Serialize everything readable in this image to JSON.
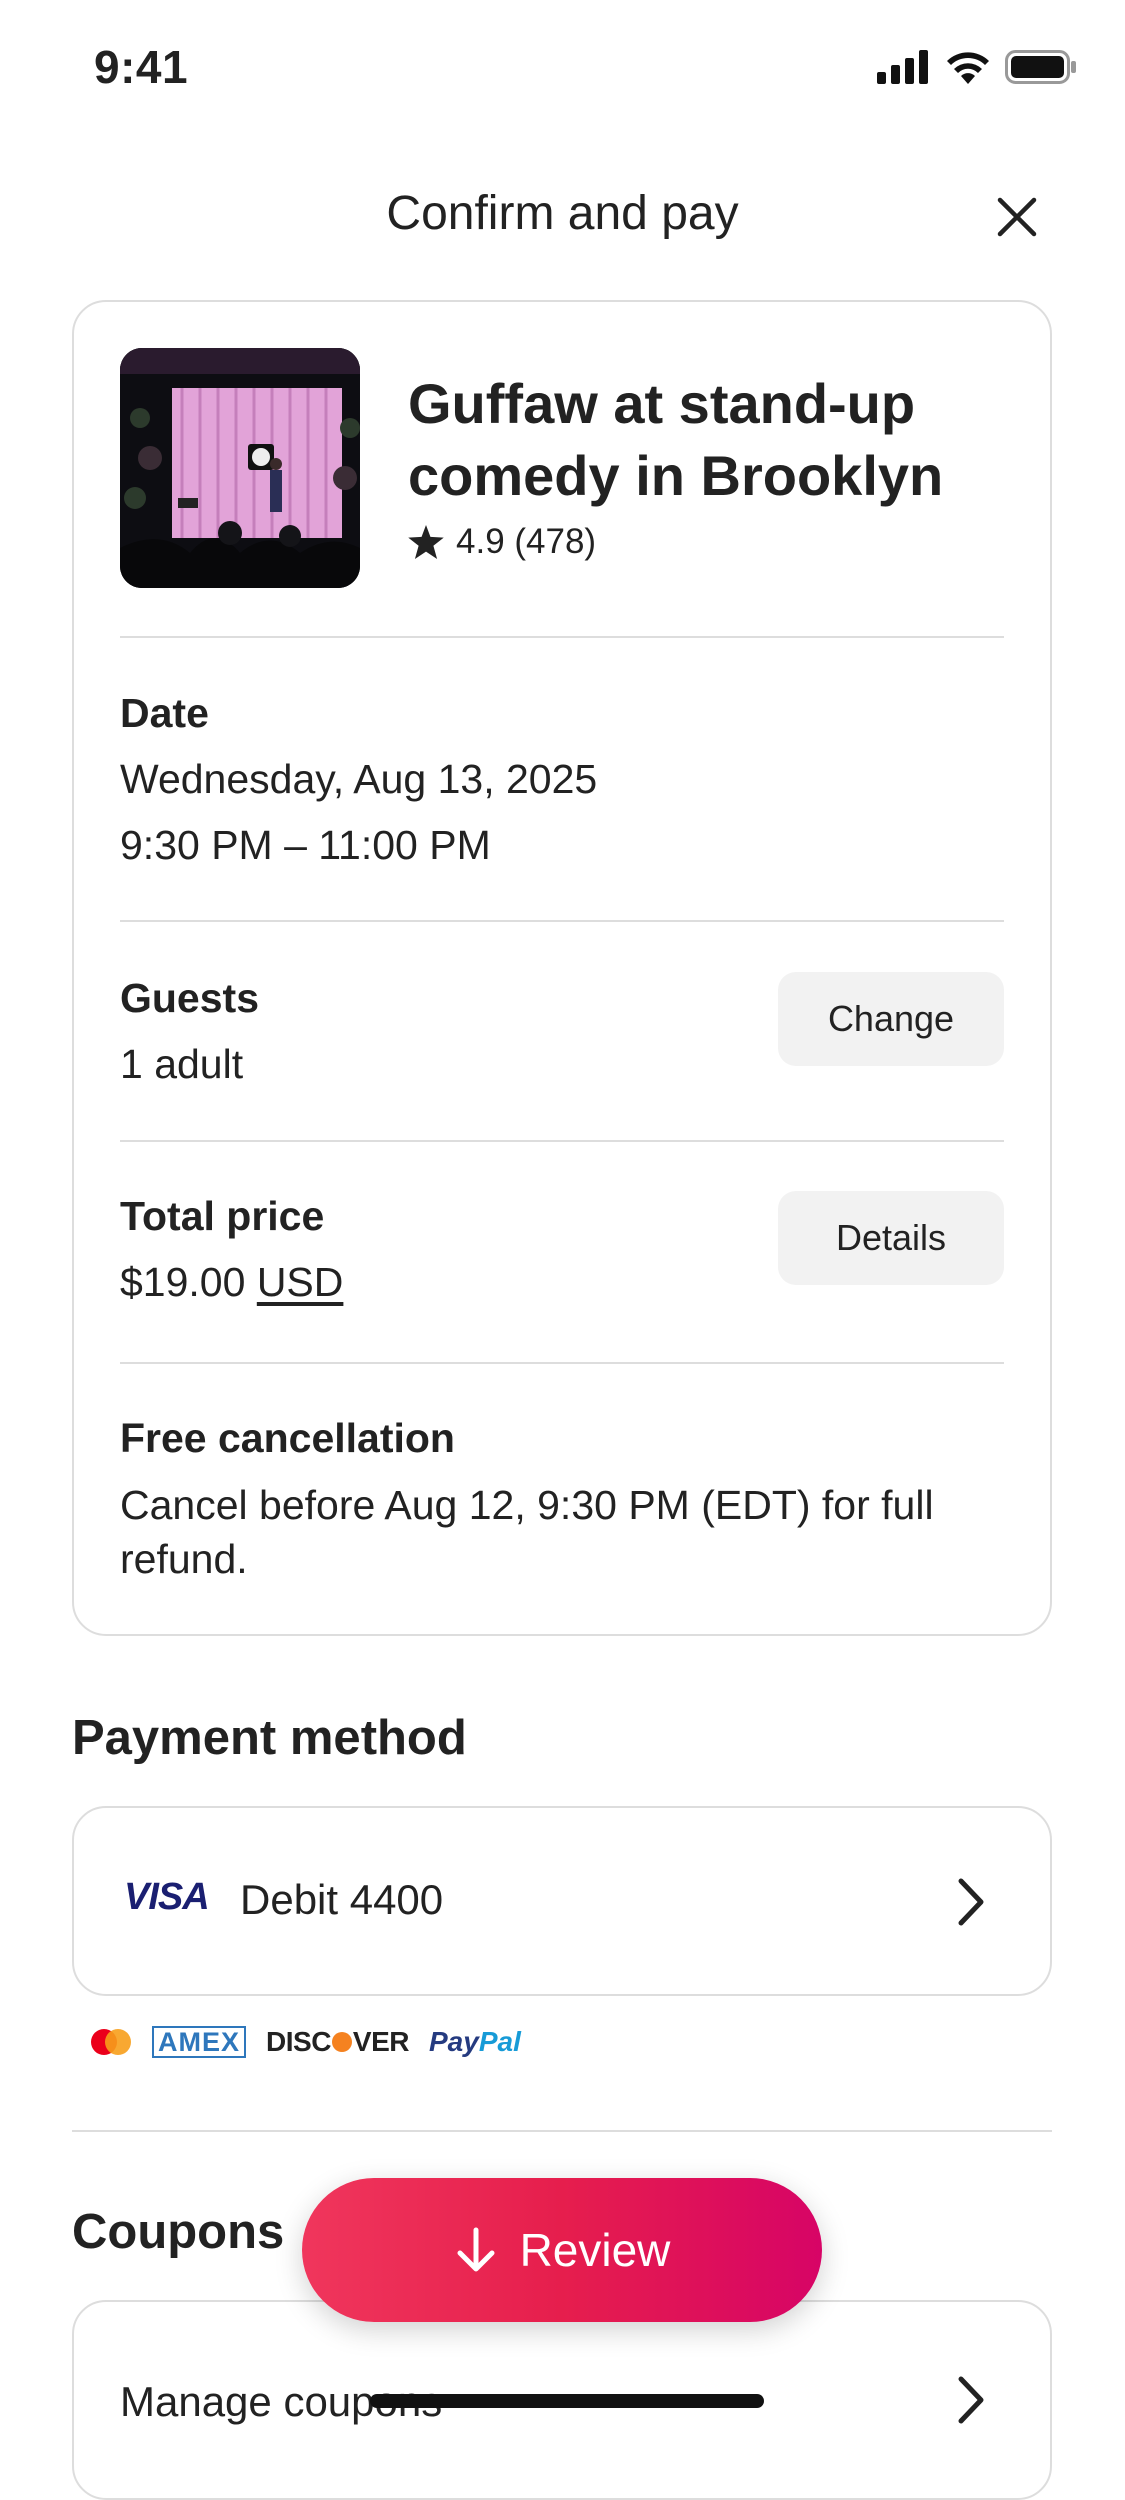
{
  "status_bar": {
    "time": "9:41"
  },
  "header": {
    "title": "Confirm and pay"
  },
  "listing": {
    "title": "Guffaw at stand-up comedy in Brooklyn",
    "rating": "4.9 (478)"
  },
  "date": {
    "label": "Date",
    "day": "Wednesday, Aug 13, 2025",
    "time": "9:30 PM – 11:00 PM"
  },
  "guests": {
    "label": "Guests",
    "value": "1 adult",
    "button": "Change"
  },
  "price": {
    "label": "Total price",
    "amount": "$19.00",
    "currency": "USD",
    "button": "Details"
  },
  "cancellation": {
    "label": "Free cancellation",
    "text": "Cancel before Aug 12, 9:30 PM (EDT) for full refund."
  },
  "payment": {
    "heading": "Payment method",
    "card_brand": "VISA",
    "card_label": "Debit 4400",
    "brands": {
      "amex": "AMEX",
      "discover_a": "DISC",
      "discover_b": "VER",
      "paypal_a": "Pay",
      "paypal_b": "Pal"
    }
  },
  "coupons": {
    "heading": "Coupons",
    "manage": "Manage coupons"
  },
  "review_button": {
    "label": "Review"
  },
  "colors": {
    "accent": "#e61e4d",
    "text": "#222222",
    "divider": "#dddddd",
    "pill_bg": "#f2f2f2"
  }
}
